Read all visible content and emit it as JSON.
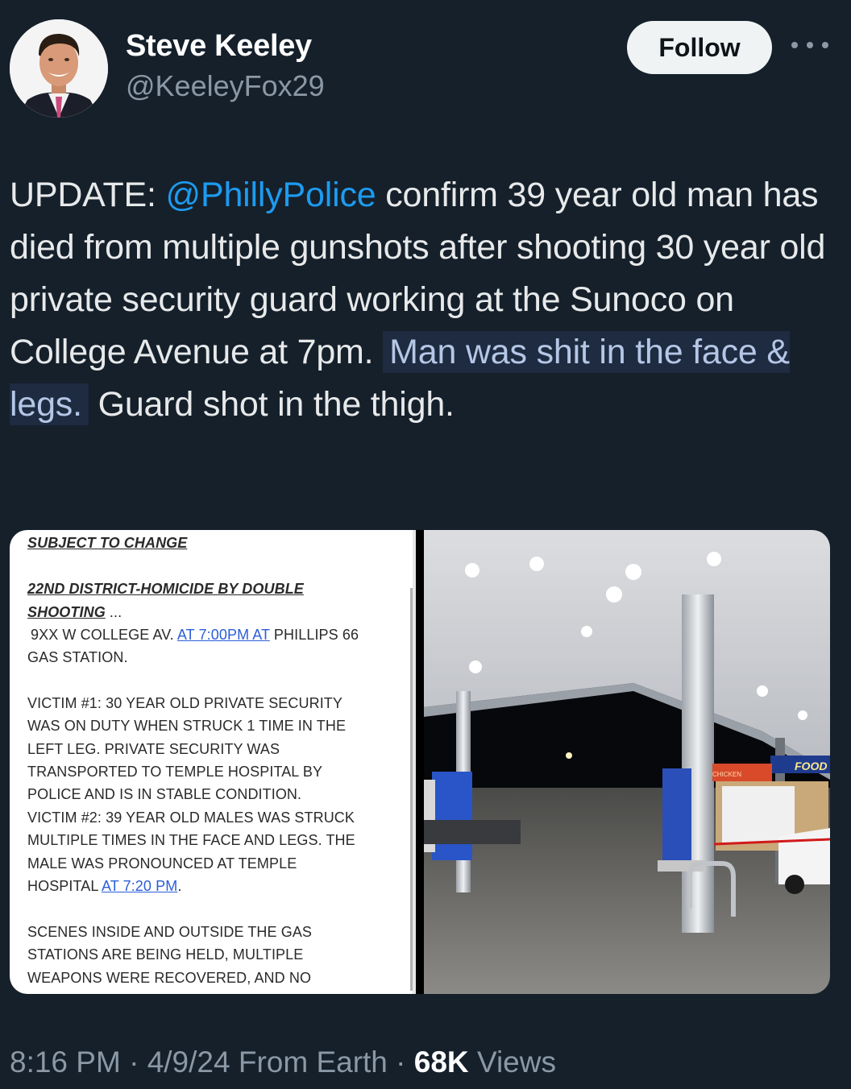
{
  "author": {
    "name": "Steve Keeley",
    "handle": "@KeeleyFox29",
    "follow_label": "Follow"
  },
  "tweet": {
    "prefix": "UPDATE: ",
    "mention": "@PhillyPolice",
    "body1": " confirm 39 year old man has died from multiple gunshots after shooting 30 year old private security guard working at the Sunoco on College Avenue at 7pm. ",
    "highlight": "Man was shit in the face & legs.",
    "body2": " Guard shot in the thigh."
  },
  "document": {
    "subject": "SUBJECT TO CHANGE",
    "title_line1": "22ND DISTRICT-HOMICIDE BY DOUBLE",
    "title_line2": "SHOOTING",
    "title_line2_suffix": " ...",
    "address_pre": "9XX W COLLEGE AV. ",
    "address_link": "AT 7:00PM  AT",
    "address_post": " PHILLIPS 66",
    "address_line2": "GAS STATION.",
    "victim_lines": [
      "VICTIM #1:  30 YEAR OLD PRIVATE SECURITY",
      "WAS ON DUTY WHEN STRUCK 1 TIME IN THE",
      "LEFT LEG.  PRIVATE SECURITY WAS",
      "TRANSPORTED TO TEMPLE HOSPITAL  BY",
      "POLICE AND IS IN STABLE CONDITION.",
      "VICTIM #2:  39 YEAR OLD MALES WAS STRUCK",
      "MULTIPLE TIMES IN THE FACE AND LEGS.   THE",
      "MALE WAS PRONOUNCED AT TEMPLE"
    ],
    "hospital_pre": "HOSPITAL  ",
    "hospital_link": "AT 7:20 PM",
    "hospital_post": ".",
    "scene_lines": [
      "SCENES INSIDE AND OUTSIDE THE GAS",
      "STATIONS ARE BEING HELD, MULTIPLE",
      "WEAPONS WERE RECOVERED, AND  NO"
    ]
  },
  "photo": {
    "sign_food": "FOOD",
    "sign_chicken": "CHICKEN"
  },
  "footer": {
    "time": "8:16 PM",
    "sep1": " · ",
    "date": "4/9/24",
    "source": " From Earth",
    "sep2": " · ",
    "views_count": "68K",
    "views_label": " Views"
  },
  "colors": {
    "background": "#15202b",
    "accent": "#1d9bf0",
    "secondary_text": "#8b98a5"
  }
}
